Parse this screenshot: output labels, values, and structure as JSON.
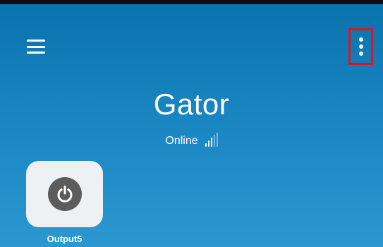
{
  "app": {
    "background_color": "#1884c0",
    "accent_highlight": "#e0141e"
  },
  "header": {
    "menu_icon": "hamburger-menu-icon",
    "more_icon": "more-vert-icon"
  },
  "device": {
    "name": "Gator",
    "status": "Online",
    "signal_icon": "signal-strength-icon",
    "signal_bars_lit": 3,
    "signal_bars_total": 5
  },
  "outputs": [
    {
      "label": "Output5",
      "icon": "power-icon"
    }
  ]
}
